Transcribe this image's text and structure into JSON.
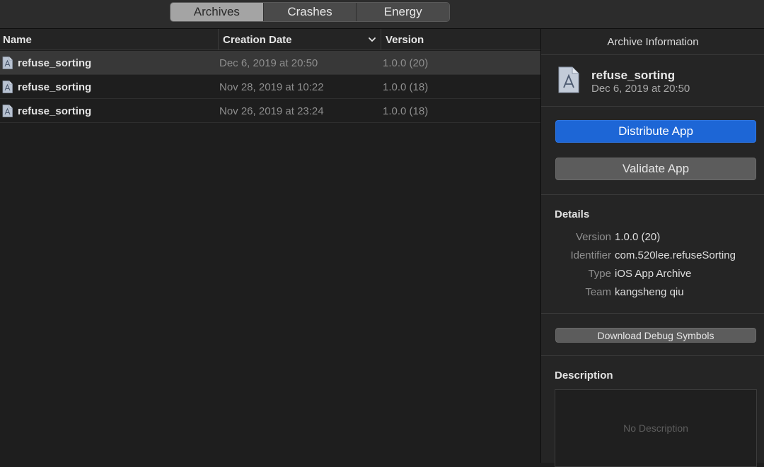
{
  "toolbar": {
    "tabs": [
      {
        "label": "Archives",
        "active": true
      },
      {
        "label": "Crashes",
        "active": false
      },
      {
        "label": "Energy",
        "active": false
      }
    ]
  },
  "list": {
    "columns": {
      "name": "Name",
      "creation_date": "Creation Date",
      "version": "Version"
    },
    "sort_icon": "chevron-down-icon",
    "rows": [
      {
        "name": "refuse_sorting",
        "date": "Dec 6, 2019 at 20:50",
        "version": "1.0.0 (20)",
        "selected": true
      },
      {
        "name": "refuse_sorting",
        "date": "Nov 28, 2019 at 10:22",
        "version": "1.0.0 (18)",
        "selected": false
      },
      {
        "name": "refuse_sorting",
        "date": "Nov 26, 2019 at 23:24",
        "version": "1.0.0 (18)",
        "selected": false
      }
    ]
  },
  "inspector": {
    "title": "Archive Information",
    "archive_name": "refuse_sorting",
    "archive_date": "Dec 6, 2019 at 20:50",
    "distribute_label": "Distribute App",
    "validate_label": "Validate App",
    "details_title": "Details",
    "details": {
      "version_key": "Version",
      "version_value": "1.0.0 (20)",
      "identifier_key": "Identifier",
      "identifier_value": "com.520lee.refuseSorting",
      "type_key": "Type",
      "type_value": "iOS App Archive",
      "team_key": "Team",
      "team_value": "kangsheng qiu"
    },
    "download_symbols_label": "Download Debug Symbols",
    "description_title": "Description",
    "description_placeholder": "No Description"
  },
  "colors": {
    "accent": "#1d66d6",
    "background": "#1e1e1e",
    "selected_row": "#383838"
  }
}
